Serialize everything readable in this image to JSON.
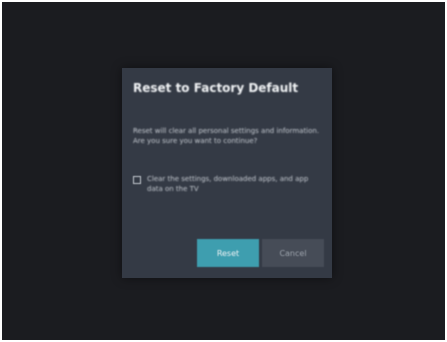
{
  "dialog": {
    "title": "Reset to Factory Default",
    "message": "Reset will clear all personal settings and information. Are you sure you want to continue?",
    "checkbox": {
      "label": "Clear the settings, downloaded apps, and app data on the TV",
      "checked": false
    },
    "buttons": {
      "reset_label": "Reset",
      "cancel_label": "Cancel"
    }
  },
  "colors": {
    "screen_background": "#1b1c20",
    "dialog_background": "#343a45",
    "primary_button": "#3e9eaf",
    "secondary_button": "#464c57"
  }
}
